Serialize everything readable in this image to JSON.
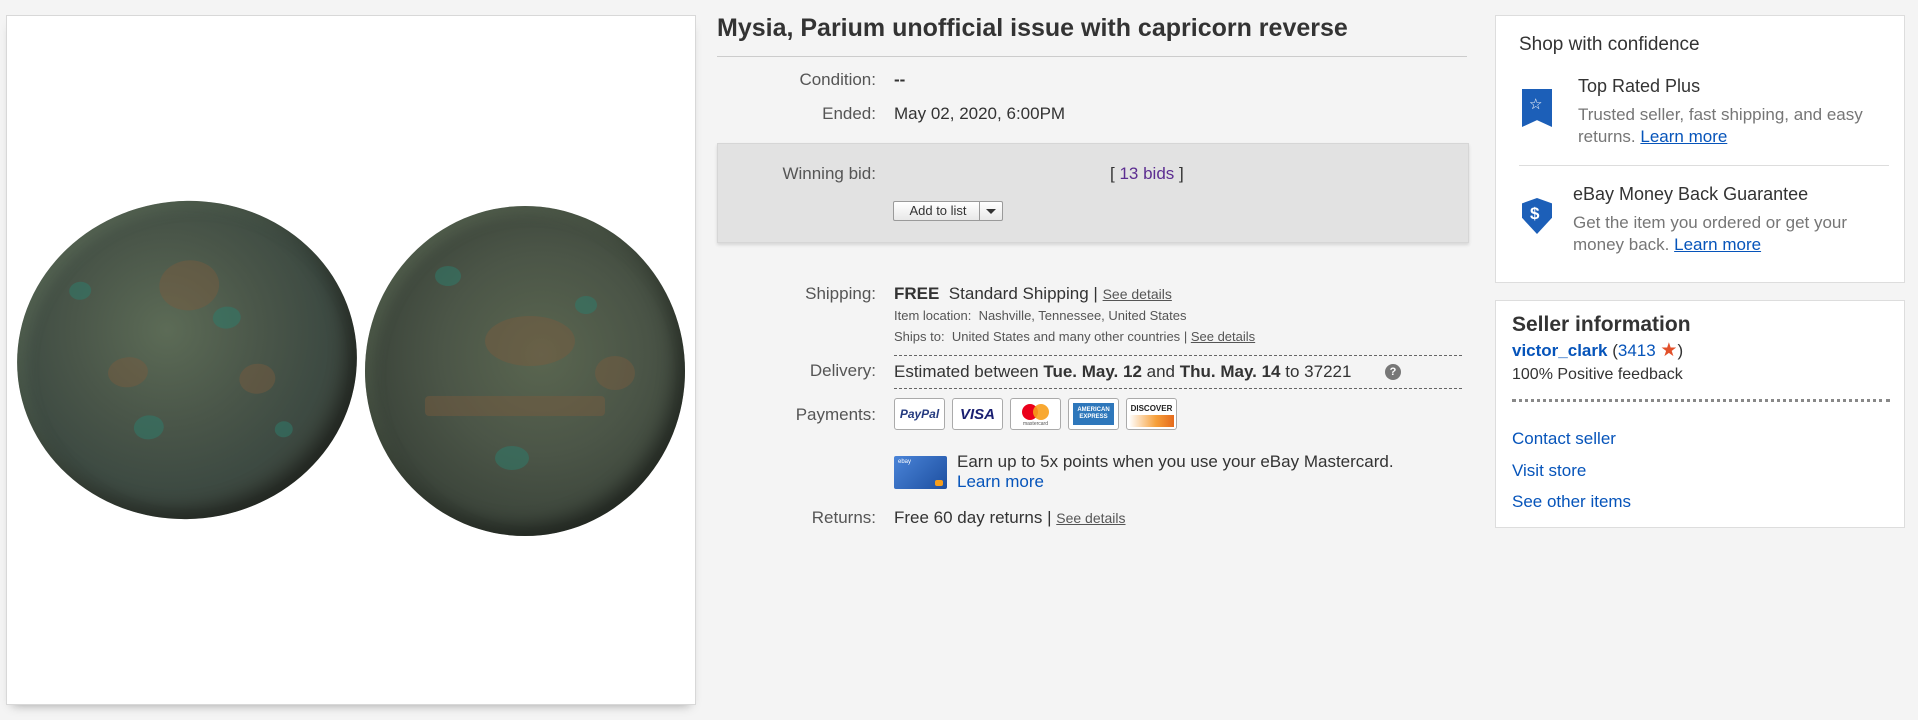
{
  "listing": {
    "title": "Mysia, Parium unofficial issue with capricorn reverse",
    "condition_label": "Condition:",
    "condition_value": "--",
    "ended_label": "Ended:",
    "ended_date": "May 02, 2020",
    "ended_sep": ",",
    "ended_time": "6:00PM",
    "winning_bid_label": "Winning bid:",
    "bids_open": "[",
    "bids_link": "13 bids",
    "bids_close": "]",
    "add_to_list_label": "Add to list"
  },
  "shipping": {
    "label": "Shipping:",
    "free": "FREE",
    "method": "Standard Shipping",
    "sep": "|",
    "see_details": "See details",
    "location_label": "Item location:",
    "location_value": "Nashville, Tennessee, United States",
    "ships_to_label": "Ships to:",
    "ships_to_value": "United States and many other countries",
    "ships_sep": "|",
    "ships_see_details": "See details"
  },
  "delivery": {
    "label": "Delivery:",
    "prefix": "Estimated between",
    "date1": "Tue. May. 12",
    "and": "and",
    "date2": "Thu. May. 14",
    "to": "to",
    "zip": "37221",
    "help_icon": "?"
  },
  "payments": {
    "label": "Payments:",
    "methods": [
      "PayPal",
      "VISA",
      "mastercard",
      "AMERICAN EXPRESS",
      "DISCOVER"
    ],
    "promo_text": "Earn up to 5x points when you use your eBay Mastercard.",
    "promo_link": "Learn more",
    "card_text": "ebay"
  },
  "returns": {
    "label": "Returns:",
    "value": "Free 60 day returns",
    "sep": "|",
    "see_details": "See details"
  },
  "shop_confidence": {
    "heading": "Shop with confidence",
    "items": [
      {
        "title": "Top Rated Plus",
        "desc": "Trusted seller, fast shipping, and easy returns.",
        "link": "Learn more",
        "icon": "top-rated-badge-icon"
      },
      {
        "title": "eBay Money Back Guarantee",
        "desc": "Get the item you ordered or get your money back.",
        "link": "Learn more",
        "icon": "money-back-shield-icon"
      }
    ]
  },
  "seller": {
    "heading": "Seller information",
    "name": "victor_clark",
    "paren_open": "(",
    "score": "3413",
    "paren_close": ")",
    "feedback": "100% Positive feedback",
    "links": [
      "Contact seller",
      "Visit store",
      "See other items"
    ]
  },
  "colors": {
    "link": "#0654ba",
    "bids_link": "#5c2d91",
    "star": "#e2502a",
    "badge": "#1c5fb8"
  }
}
